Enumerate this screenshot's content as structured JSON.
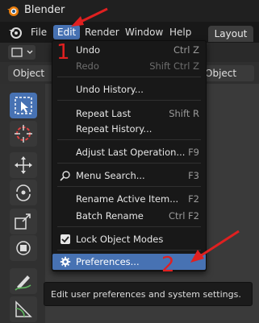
{
  "window": {
    "title": "Blender"
  },
  "menubar": {
    "items": [
      "File",
      "Edit",
      "Render",
      "Window",
      "Help"
    ],
    "active": "Edit",
    "workspace_tab": "Layout"
  },
  "header": {
    "left_mode": "Object",
    "right_mode": "Object"
  },
  "edit_menu": {
    "items": [
      {
        "label": "Undo",
        "shortcut": "Ctrl Z",
        "enabled": true
      },
      {
        "label": "Redo",
        "shortcut": "Shift Ctrl Z",
        "enabled": false
      },
      {
        "label": "Undo History...",
        "shortcut": "",
        "enabled": true
      },
      {
        "label": "Repeat Last",
        "shortcut": "Shift R",
        "enabled": true
      },
      {
        "label": "Repeat History...",
        "shortcut": "",
        "enabled": true
      },
      {
        "label": "Adjust Last Operation...",
        "shortcut": "F9",
        "enabled": true
      },
      {
        "label": "Menu Search...",
        "shortcut": "F3",
        "enabled": true,
        "icon": "search-icon"
      },
      {
        "label": "Rename Active Item...",
        "shortcut": "F2",
        "enabled": true
      },
      {
        "label": "Batch Rename",
        "shortcut": "Ctrl F2",
        "enabled": true
      },
      {
        "label": "Lock Object Modes",
        "shortcut": "",
        "enabled": true,
        "checked": true
      },
      {
        "label": "Preferences...",
        "shortcut": "",
        "enabled": true,
        "highlighted": true,
        "icon": "gear-icon"
      }
    ]
  },
  "tooltip": {
    "text": "Edit user preferences and system settings."
  },
  "annotations": {
    "step1": "1",
    "step2": "2",
    "color": "#e02020"
  },
  "colors": {
    "accent": "#4772b3",
    "menu_bg": "#181818",
    "app_bg": "#303030"
  }
}
